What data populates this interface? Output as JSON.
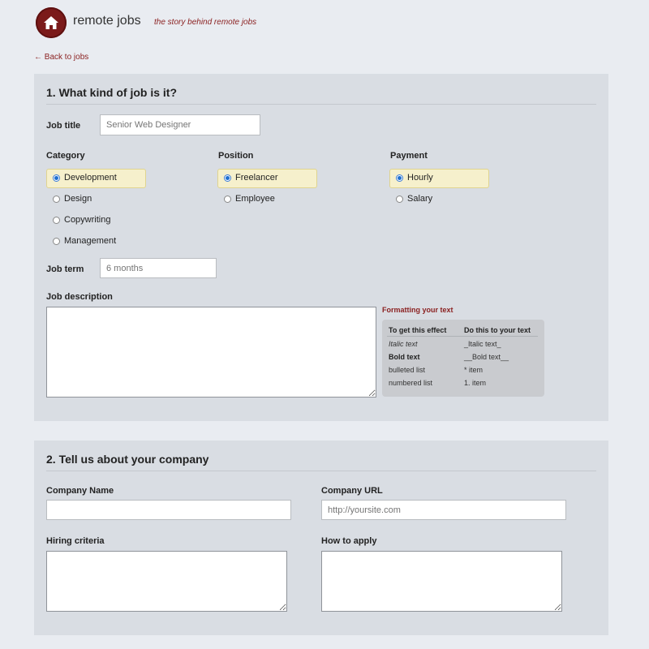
{
  "brand": {
    "name": "remote jobs",
    "tagline": "the story behind remote jobs",
    "logo_icon": "home-icon",
    "accent": "#7b1a1a"
  },
  "nav": {
    "back_link": "← Back to jobs"
  },
  "section1": {
    "title": "1. What kind of job is it?",
    "job_title_label": "Job title",
    "job_title_placeholder": "Senior Web Designer",
    "category": {
      "label": "Category",
      "options": [
        "Development",
        "Design",
        "Copywriting",
        "Management"
      ],
      "selected": "Development"
    },
    "position": {
      "label": "Position",
      "options": [
        "Freelancer",
        "Employee"
      ],
      "selected": "Freelancer"
    },
    "payment": {
      "label": "Payment",
      "options": [
        "Hourly",
        "Salary"
      ],
      "selected": "Hourly"
    },
    "job_term_label": "Job term",
    "job_term_placeholder": "6 months",
    "job_description_label": "Job description",
    "job_description_value": "",
    "formatting": {
      "title": "Formatting your text",
      "headers": [
        "To get this effect",
        "Do this to your text"
      ],
      "rows": [
        [
          "Italic text",
          "_Italic text_"
        ],
        [
          "Bold text",
          "__Bold text__"
        ],
        [
          "bulleted list",
          "* item"
        ],
        [
          "numbered list",
          "1. item"
        ]
      ]
    }
  },
  "section2": {
    "title": "2. Tell us about your company",
    "company_name_label": "Company Name",
    "company_name_value": "",
    "company_url_label": "Company URL",
    "company_url_placeholder": "http://yoursite.com",
    "hiring_criteria_label": "Hiring criteria",
    "hiring_criteria_value": "",
    "how_to_apply_label": "How to apply",
    "how_to_apply_value": ""
  }
}
